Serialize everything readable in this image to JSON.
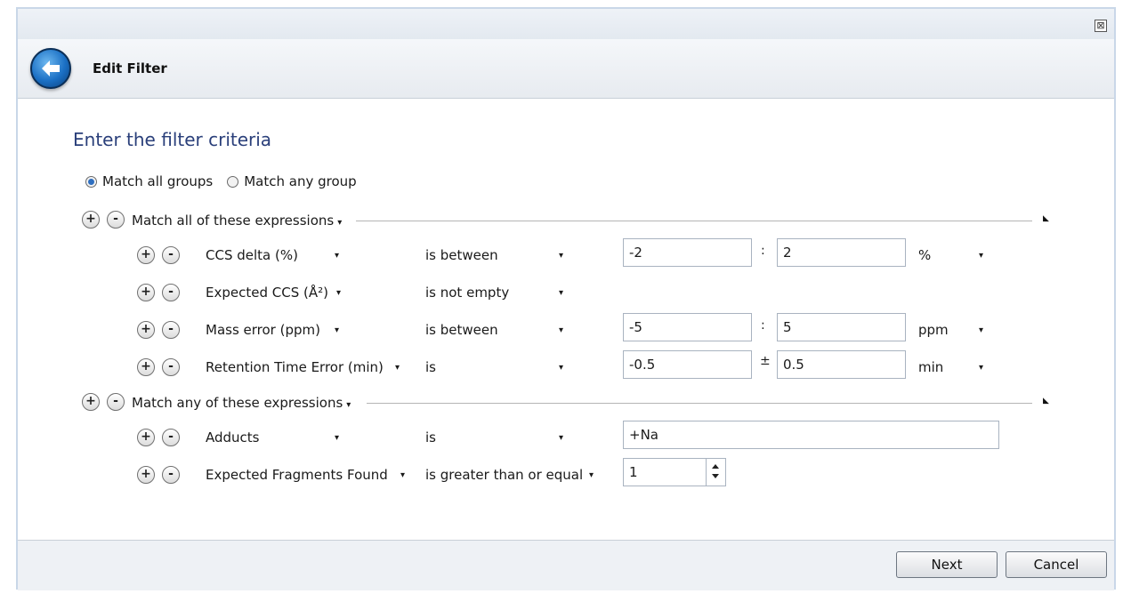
{
  "window": {
    "close_glyph": "⊠"
  },
  "header": {
    "title": "Edit Filter",
    "back_icon": "back-arrow-icon"
  },
  "main": {
    "section_title": "Enter the filter criteria",
    "match_mode": {
      "options": [
        "Match all groups",
        "Match any group"
      ],
      "selected": "Match all groups"
    },
    "groups": [
      {
        "label": "Match all of these expressions",
        "rows": [
          {
            "field": "CCS delta (%)",
            "operator": "is between",
            "value1": "-2",
            "separator": ":",
            "value2": "2",
            "unit": "%"
          },
          {
            "field": "Expected CCS (Å²)",
            "operator": "is not empty"
          },
          {
            "field": "Mass error (ppm)",
            "operator": "is between",
            "value1": "-5",
            "separator": ":",
            "value2": "5",
            "unit": "ppm"
          },
          {
            "field": "Retention Time Error (min)",
            "operator": "is",
            "value1": "-0.5",
            "separator": "±",
            "value2": "0.5",
            "unit": "min"
          }
        ]
      },
      {
        "label": "Match any of these expressions",
        "rows": [
          {
            "field": "Adducts",
            "operator": "is",
            "value1": "+Na"
          },
          {
            "field": "Expected Fragments Found",
            "operator": "is greater than or equal",
            "value1": "1"
          }
        ]
      }
    ]
  },
  "footer": {
    "next_label": "Next",
    "cancel_label": "Cancel"
  },
  "glyphs": {
    "plus": "+",
    "minus": "-",
    "caret": "▾",
    "corner": "◣"
  }
}
